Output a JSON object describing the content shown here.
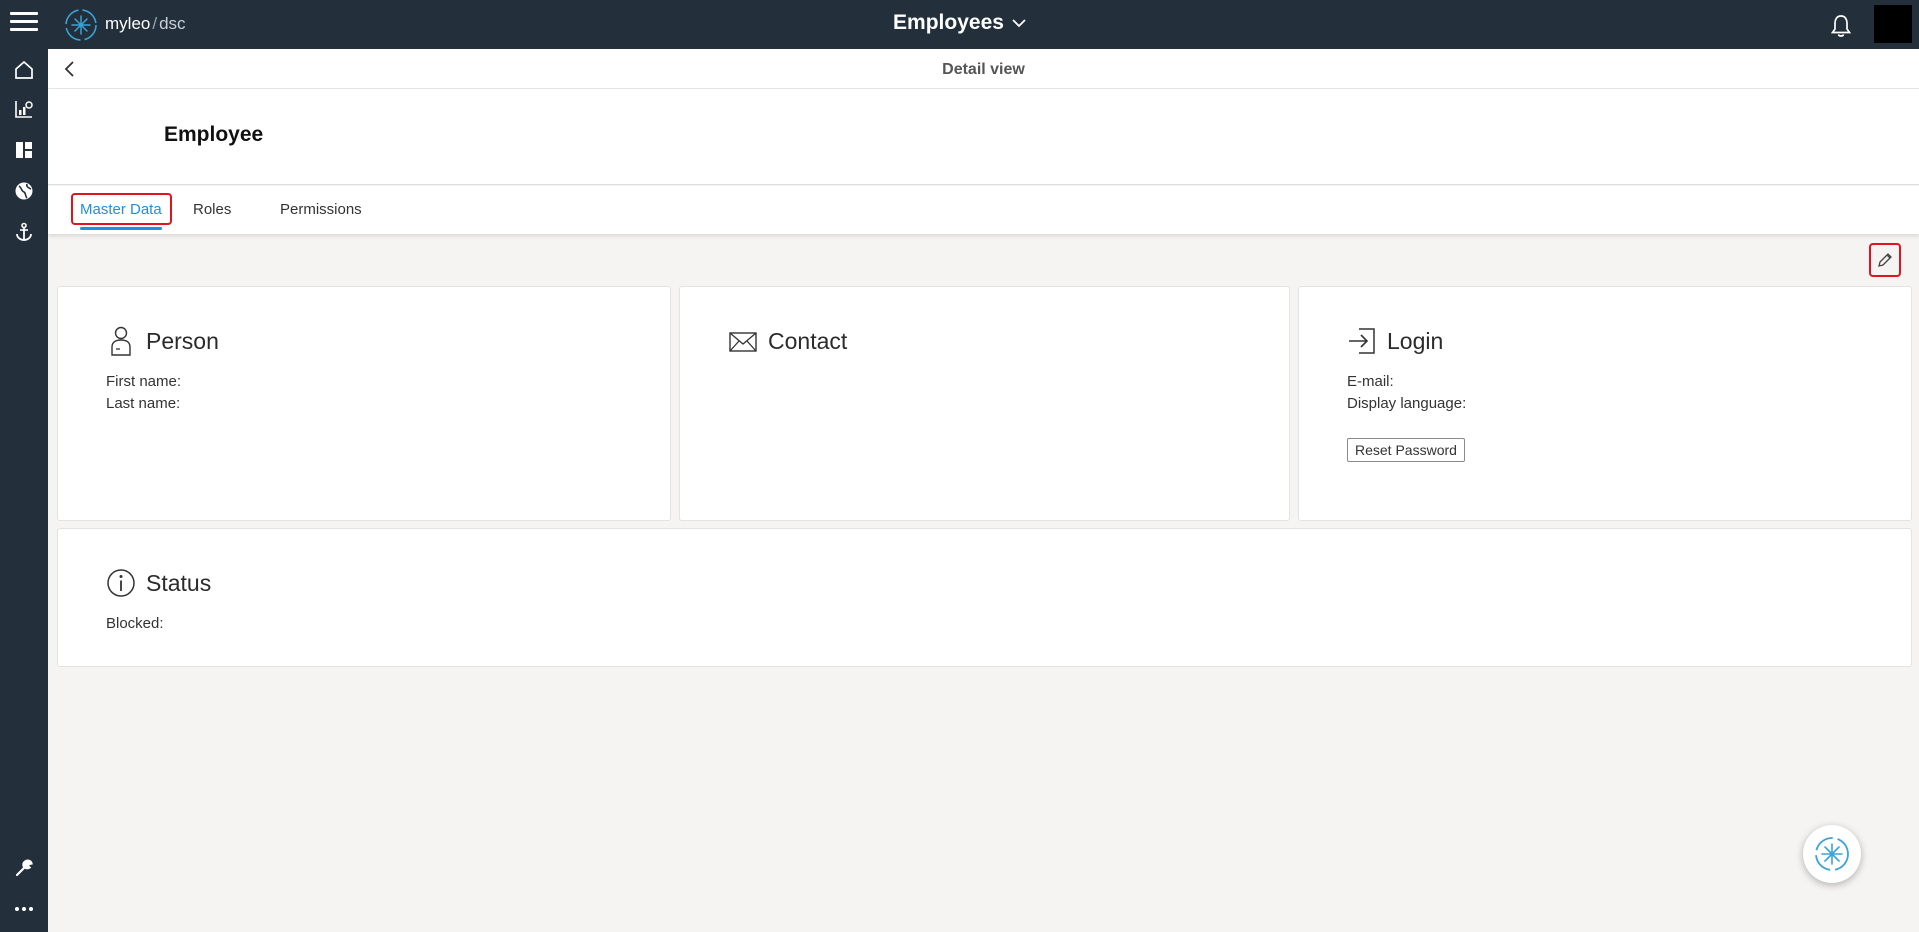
{
  "app": {
    "brand_primary": "myleo",
    "brand_separator": "/",
    "brand_secondary": "dsc",
    "title": "Employees",
    "title_icon": "chevron-down-icon",
    "colors": {
      "topbar": "#232f3b",
      "accent": "#1f8fe0",
      "highlight": "#e0141e"
    }
  },
  "sidebar": {
    "items": [
      {
        "icon": "home-icon"
      },
      {
        "icon": "analytics-icon"
      },
      {
        "icon": "dashboard-icon"
      },
      {
        "icon": "globe-icon"
      },
      {
        "icon": "anchor-icon"
      },
      {
        "icon": "wrench-icon"
      },
      {
        "icon": "more-icon"
      }
    ]
  },
  "detail": {
    "header": "Detail view",
    "title": "Employee"
  },
  "tabs": [
    {
      "label": "Master Data",
      "active": true
    },
    {
      "label": "Roles",
      "active": false
    },
    {
      "label": "Permissions",
      "active": false
    }
  ],
  "cards": {
    "person": {
      "title": "Person",
      "icon": "person-icon",
      "fields": [
        "First name:",
        "Last name:"
      ]
    },
    "contact": {
      "title": "Contact",
      "icon": "envelope-icon"
    },
    "login": {
      "title": "Login",
      "icon": "login-icon",
      "fields": [
        "E-mail:",
        "Display language:"
      ],
      "button": "Reset Password"
    },
    "status": {
      "title": "Status",
      "icon": "info-icon",
      "fields": [
        "Blocked:"
      ]
    }
  }
}
